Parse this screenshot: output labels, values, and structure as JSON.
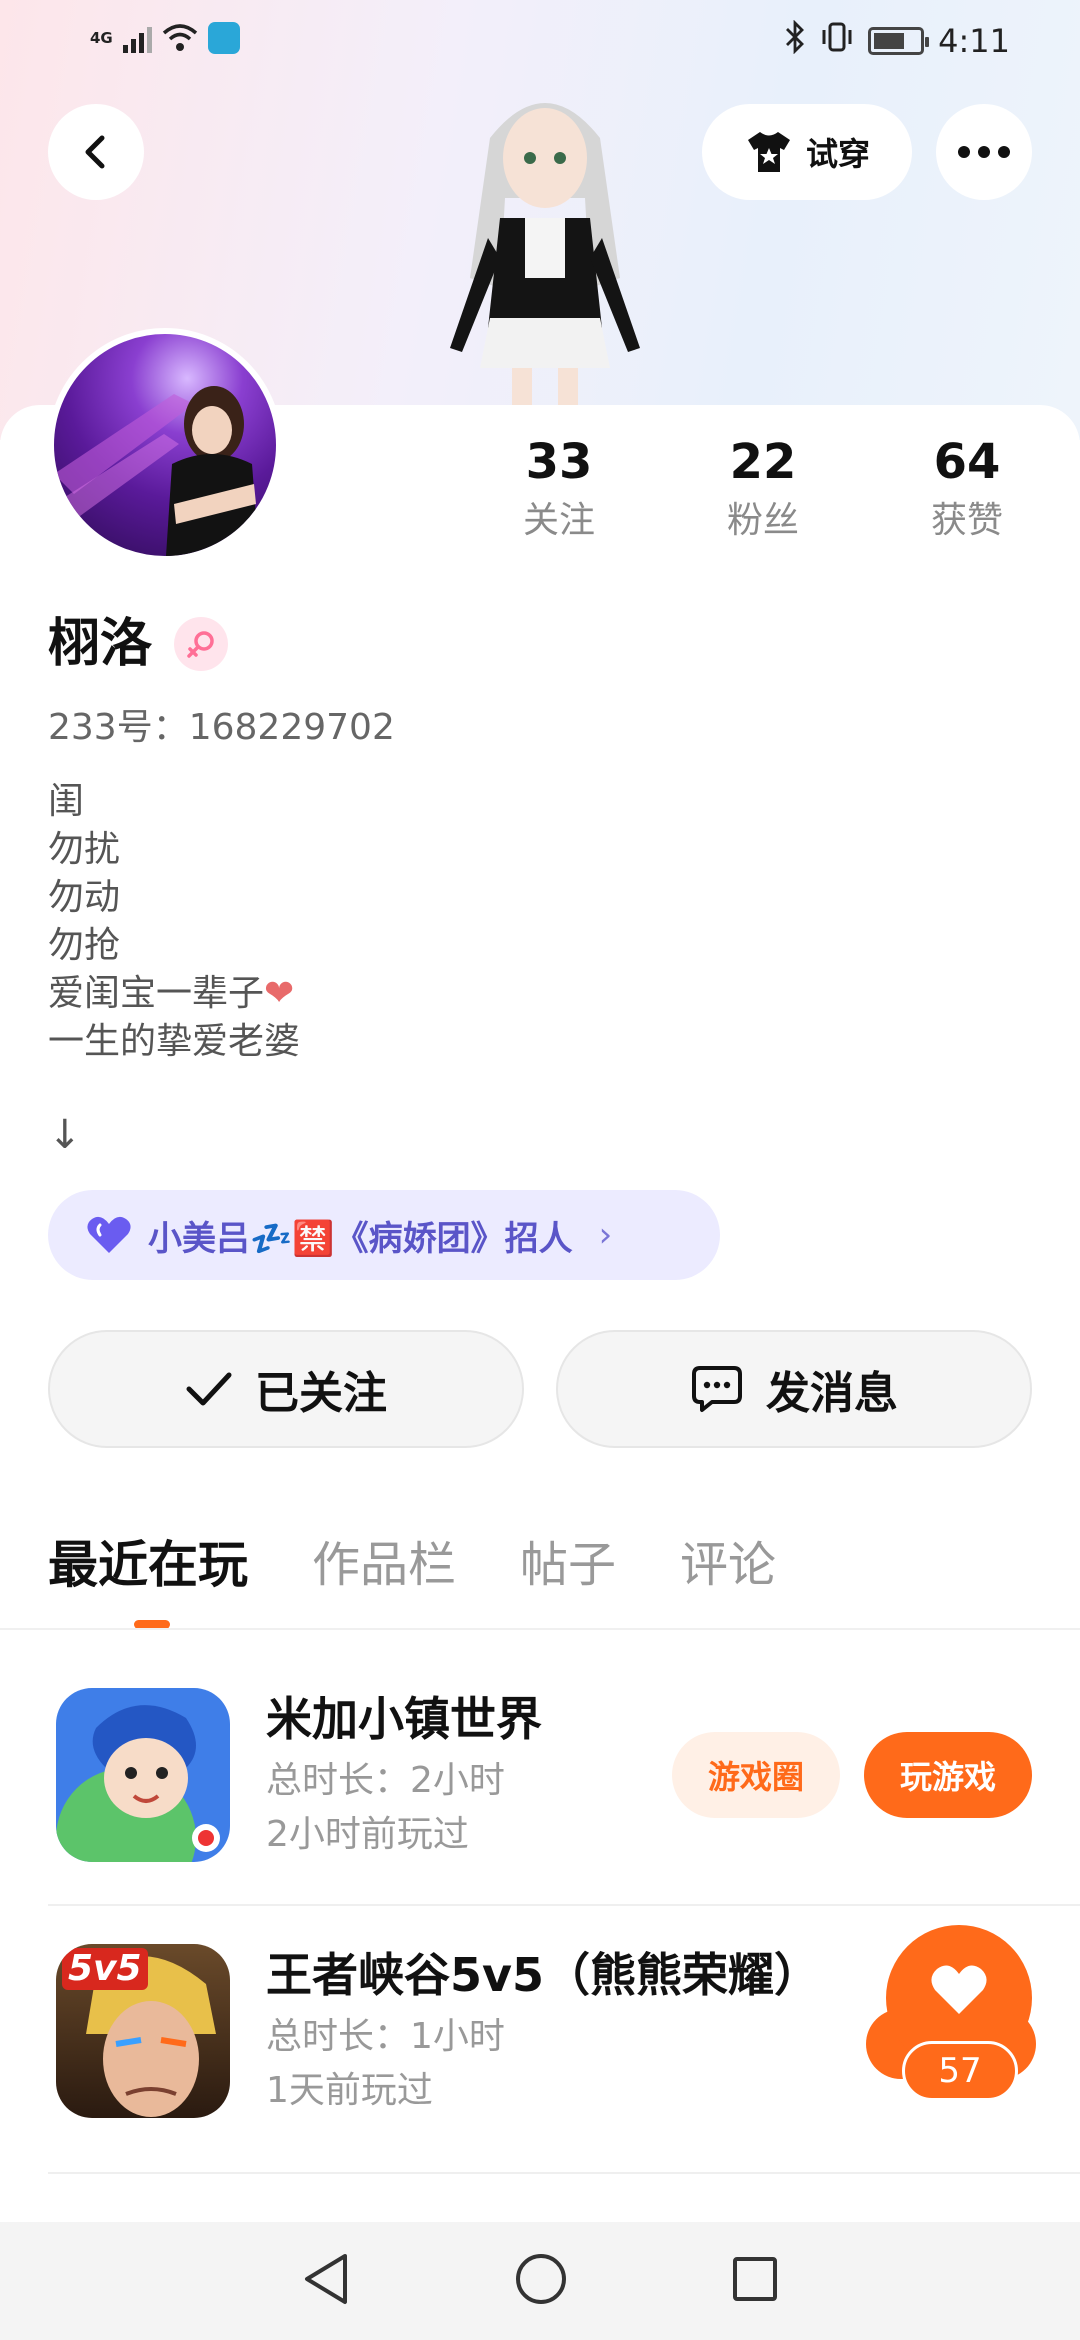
{
  "status_bar": {
    "network_tag": "4G",
    "time": "4:11"
  },
  "header": {
    "try_on_label": "试穿"
  },
  "profile": {
    "stats": [
      {
        "value": "33",
        "label": "关注"
      },
      {
        "value": "22",
        "label": "粉丝"
      },
      {
        "value": "64",
        "label": "获赞"
      }
    ],
    "name": "栩洛",
    "uid_text": "233号：168229702",
    "bio_lines": [
      "闺",
      "勿扰",
      "勿动",
      "勿抢",
      "爱闺宝一辈子",
      "一生的挚爱老婆"
    ],
    "bio_heart": "❤",
    "arrow": "↓"
  },
  "group": {
    "label": "小美吕💤🈲《病娇团》招人",
    "chevron": "›"
  },
  "actions": {
    "followed_label": "已关注",
    "message_label": "发消息"
  },
  "tabs": [
    {
      "label": "最近在玩",
      "active": true
    },
    {
      "label": "作品栏",
      "active": false
    },
    {
      "label": "帖子",
      "active": false
    },
    {
      "label": "评论",
      "active": false
    }
  ],
  "games": [
    {
      "title": "米加小镇世界",
      "duration": "总时长：2小时",
      "last_played": "2小时前玩过",
      "circle_label": "游戏圈",
      "play_label": "玩游戏"
    },
    {
      "title": "王者峡谷5v5（熊熊荣耀）",
      "duration": "总时长：1小时",
      "last_played": "1天前玩过",
      "icon_badge": "5v5"
    }
  ],
  "like_float": {
    "count": "57"
  },
  "colors": {
    "accent": "#ff6a1a",
    "group_chip_bg": "#ecebff",
    "group_chip_text": "#5a55c8"
  },
  "icons": [
    "back-arrow-icon",
    "tshirt-icon",
    "more-icon",
    "female-icon",
    "purple-heart-icon",
    "check-icon",
    "chat-bubble-icon",
    "heart-icon",
    "nav-back-icon",
    "nav-home-icon",
    "nav-recents-icon"
  ]
}
